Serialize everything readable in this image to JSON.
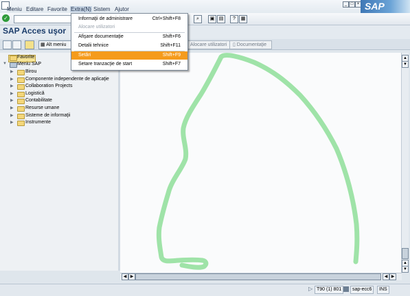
{
  "menubar": {
    "items": [
      "Meniu",
      "Editare",
      "Favorite",
      "Extra(N)",
      "Sistem",
      "Ajutor"
    ]
  },
  "window": {
    "brand": "SAP"
  },
  "title": "SAP Acces uşor",
  "app_toolbar": {
    "other_menu_label": "Alt meniu",
    "assign_users_label": "Alocare utilizatori",
    "documentation_label": "Documentaţie"
  },
  "tree": {
    "favorites": "Favorite",
    "root": "Meniu SAP",
    "items": [
      "Birou",
      "Componente independente de aplicaţie",
      "Collaboration Projects",
      "Logistică",
      "Contabilitate",
      "Resurse umane",
      "Sisteme de informaţii",
      "Instrumente"
    ]
  },
  "dropdown": {
    "items": [
      {
        "label": "Informaţii de administrare",
        "shortcut": "Ctrl+Shift+F8",
        "state": "normal"
      },
      {
        "label": "Alocare utilizatori",
        "shortcut": "",
        "state": "disabled"
      },
      {
        "label": "Afişare documentaţie",
        "shortcut": "Shift+F6",
        "state": "normal"
      },
      {
        "label": "Detalii tehnice",
        "shortcut": "Shift+F11",
        "state": "normal"
      },
      {
        "label": "Setări",
        "shortcut": "Shift+F9",
        "state": "selected"
      },
      {
        "label": "Setare tranzacţie de start",
        "shortcut": "Shift+F7",
        "state": "normal"
      }
    ]
  },
  "status": {
    "system": "T90 (1) 801",
    "server": "sap-ecc6",
    "mode": "INS"
  },
  "colors": {
    "highlight": "#f59b1c",
    "annotation_stroke": "#9fe3a8",
    "title": "#1c3d6b"
  }
}
